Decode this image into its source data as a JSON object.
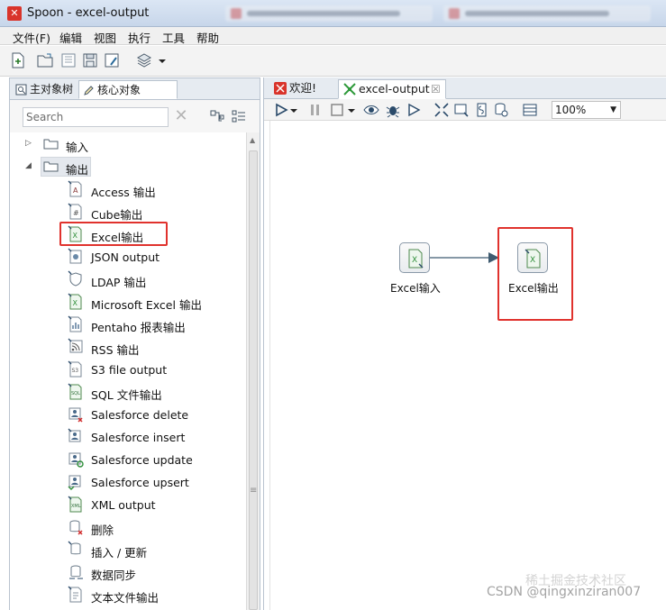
{
  "window": {
    "title": "Spoon - excel-output"
  },
  "menu": [
    "文件(F)",
    "编辑",
    "视图",
    "执行",
    "工具",
    "帮助"
  ],
  "left_panel": {
    "tabs": [
      {
        "label": "主对象树",
        "icon": "tree-icon"
      },
      {
        "label": "核心对象",
        "icon": "pencil-icon"
      }
    ],
    "search_placeholder": "Search",
    "folders": [
      {
        "label": "输入",
        "expanded": false
      },
      {
        "label": "输出",
        "expanded": true
      }
    ],
    "items": [
      {
        "label": "Access 输出",
        "icon": "access-output-icon"
      },
      {
        "label": "Cube输出",
        "icon": "cube-output-icon"
      },
      {
        "label": "Excel输出",
        "icon": "excel-output-icon"
      },
      {
        "label": "JSON output",
        "icon": "json-output-icon"
      },
      {
        "label": "LDAP 输出",
        "icon": "ldap-output-icon"
      },
      {
        "label": "Microsoft Excel 输出",
        "icon": "ms-excel-output-icon"
      },
      {
        "label": "Pentaho 报表输出",
        "icon": "pentaho-report-icon"
      },
      {
        "label": "RSS 输出",
        "icon": "rss-output-icon"
      },
      {
        "label": "S3 file output",
        "icon": "s3-output-icon"
      },
      {
        "label": "SQL 文件输出",
        "icon": "sql-file-output-icon"
      },
      {
        "label": "Salesforce delete",
        "icon": "salesforce-delete-icon"
      },
      {
        "label": "Salesforce insert",
        "icon": "salesforce-insert-icon"
      },
      {
        "label": "Salesforce update",
        "icon": "salesforce-update-icon"
      },
      {
        "label": "Salesforce upsert",
        "icon": "salesforce-upsert-icon"
      },
      {
        "label": "XML output",
        "icon": "xml-output-icon"
      },
      {
        "label": "删除",
        "icon": "delete-table-icon"
      },
      {
        "label": "插入 / 更新",
        "icon": "insert-update-icon"
      },
      {
        "label": "数据同步",
        "icon": "sync-icon"
      },
      {
        "label": "文本文件输出",
        "icon": "text-file-output-icon"
      }
    ]
  },
  "editor": {
    "tabs": [
      {
        "label": "欢迎!",
        "icon": "spoon-icon"
      },
      {
        "label": "excel-output",
        "icon": "transformation-icon"
      }
    ],
    "zoom": "100%",
    "steps": [
      {
        "label": "Excel输入",
        "icon": "excel-input-icon"
      },
      {
        "label": "Excel输出",
        "icon": "excel-output-icon"
      }
    ]
  },
  "watermark": "CSDN @qingxinziran007",
  "watermark_faint": "稀土掘金技术社区",
  "colors": {
    "highlight_red": "#e0322d",
    "excel_green": "#2f8f3a",
    "hop_arrow": "#3f5b70"
  }
}
